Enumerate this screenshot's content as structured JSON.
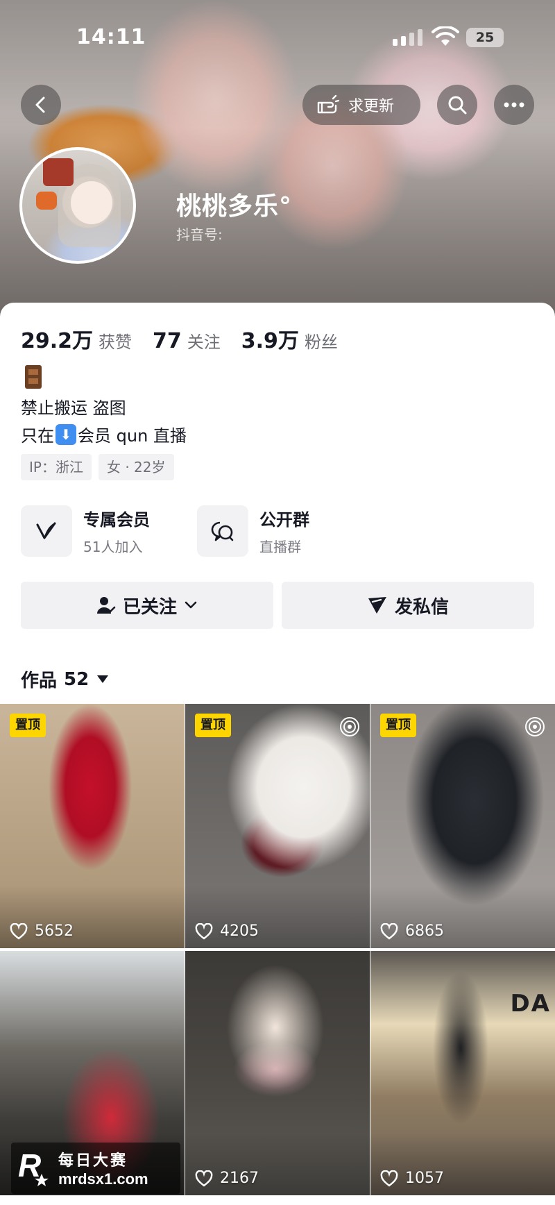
{
  "status_bar": {
    "time": "14:11",
    "battery": "25"
  },
  "header": {
    "update_label": "求更新"
  },
  "profile": {
    "nickname": "桃桃多乐°",
    "douyin_id_label": "抖音号:"
  },
  "stats": [
    {
      "value": "29.2万",
      "label": "获赞"
    },
    {
      "value": "77",
      "label": "关注"
    },
    {
      "value": "3.9万",
      "label": "粉丝"
    }
  ],
  "bio": {
    "line1": "禁止搬运 盗图",
    "line2_prefix": "只在",
    "line2_suffix": "会员 qun 直播"
  },
  "tags": [
    "IP：浙江",
    "女 · 22岁"
  ],
  "features": {
    "vip": {
      "title": "专属会员",
      "subtitle": "51人加入"
    },
    "group": {
      "title": "公开群",
      "subtitle": "直播群"
    }
  },
  "actions": {
    "follow": "已关注",
    "message": "发私信"
  },
  "works": {
    "label": "作品",
    "count": "52"
  },
  "videos": [
    {
      "pinned": true,
      "pin_label": "置顶",
      "likes": "5652",
      "live": false
    },
    {
      "pinned": true,
      "pin_label": "置顶",
      "likes": "4205",
      "live": true
    },
    {
      "pinned": true,
      "pin_label": "置顶",
      "likes": "6865",
      "live": true
    },
    {
      "pinned": false,
      "pin_label": "",
      "likes": "",
      "live": false
    },
    {
      "pinned": false,
      "pin_label": "",
      "likes": "2167",
      "live": false
    },
    {
      "pinned": false,
      "pin_label": "",
      "likes": "1057",
      "live": false,
      "sign_text": "DA"
    }
  ],
  "watermark": {
    "logo": "R",
    "title": "每日大赛",
    "url": "mrdsx1.com"
  },
  "colors": {
    "pin_bg": "#fdd500",
    "text_primary": "#161823",
    "text_secondary": "#6e6f76"
  },
  "icons": [
    "back-icon",
    "hand-point-icon",
    "search-icon",
    "more-icon",
    "vip-v-icon",
    "group-chat-icon",
    "user-check-icon",
    "chevron-down-icon",
    "send-icon",
    "heart-icon",
    "live-icon"
  ]
}
